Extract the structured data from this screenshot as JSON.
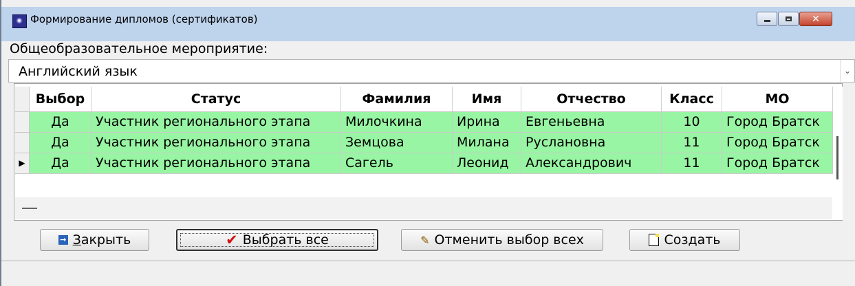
{
  "window": {
    "title": "Формирование дипломов (сертификатов)",
    "icon": "app-icon",
    "controls": {
      "minimize": "minimize-icon",
      "maximize": "maximize-icon",
      "close": "✕"
    }
  },
  "event": {
    "label": "Общеобразовательное мероприятие:",
    "selected": "Английский язык",
    "dropdown_glyph": "⌄"
  },
  "grid": {
    "columns": [
      "Выбор",
      "Статус",
      "Фамилия",
      "Имя",
      "Отчество",
      "Класс",
      "МО"
    ],
    "rows": [
      {
        "choice": "Да",
        "status": "Участник регионального этапа",
        "surname": "Милочкина",
        "name": "Ирина",
        "patronymic": "Евгеньевна",
        "grade": "10",
        "mo": "Город Братск"
      },
      {
        "choice": "Да",
        "status": "Участник регионального этапа",
        "surname": "Земцова",
        "name": "Милана",
        "patronymic": "Руслановна",
        "grade": "11",
        "mo": "Город Братск"
      },
      {
        "choice": "Да",
        "status": "Участник регионального этапа",
        "surname": "Сагель",
        "name": "Леонид",
        "patronymic": "Александрович",
        "grade": "11",
        "mo": "Город Братск"
      }
    ],
    "current_row_marker": "▶",
    "row_color": "#98f5a3"
  },
  "buttons": {
    "close_underlined": "З",
    "close_rest": "акрыть",
    "select_all": "Выбрать все",
    "cancel_all": "Отменить выбор всех",
    "create": "Создать"
  },
  "icons": {
    "close": "→",
    "select_all": "✔",
    "cancel_all": "✎"
  },
  "colors": {
    "title_bar": "#bed3ec",
    "close_button": "#c5432b",
    "row_selected": "#98f5a3"
  }
}
